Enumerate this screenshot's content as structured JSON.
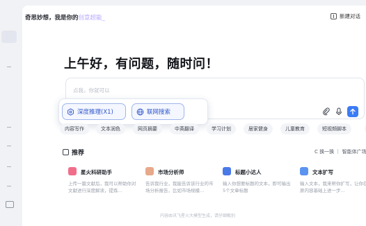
{
  "header": {
    "tagline_main": "奇思妙想，我是你的",
    "tagline_accent": "创意超能",
    "tagline_cursor": "_",
    "new_chat_label": "新建对话"
  },
  "greeting": "上午好，有问题，随时问！",
  "composer": {
    "placeholder": "点我，你就可以"
  },
  "modes": {
    "deep_reasoning": "深度推理(X1)",
    "web_search": "联网搜索"
  },
  "chips": [
    "内容写作",
    "文本润色",
    "网页摘要",
    "中英翻译",
    "学习计划",
    "居家健身",
    "儿童教育",
    "短视频脚本",
    "更多"
  ],
  "recommend": {
    "title": "推荐",
    "swap_label": "C 换一换 ｜ 智能体广场"
  },
  "cards": [
    {
      "name": "星火科研助手",
      "desc": "上传一篇文献后，我可以帮助你对文献进行深度解读，提炼…",
      "color": "#f16e8a"
    },
    {
      "name": "市场分析师",
      "desc": "告诉我行业，我能告诉该行业的市场分析报告，比如市场规模…",
      "color": "#e8a88a"
    },
    {
      "name": "标题小达人",
      "desc": "输入你想要标题的文本，即可输出5个文章标题",
      "color": "#4a79e8"
    },
    {
      "name": "文本扩写",
      "desc": "输入文本，我来帮你扩写，让你在原内容基础上进一步…",
      "color": "#5b93f0"
    }
  ],
  "footer_note": "内容由讯飞星火大模型生成，请仔细甄别"
}
